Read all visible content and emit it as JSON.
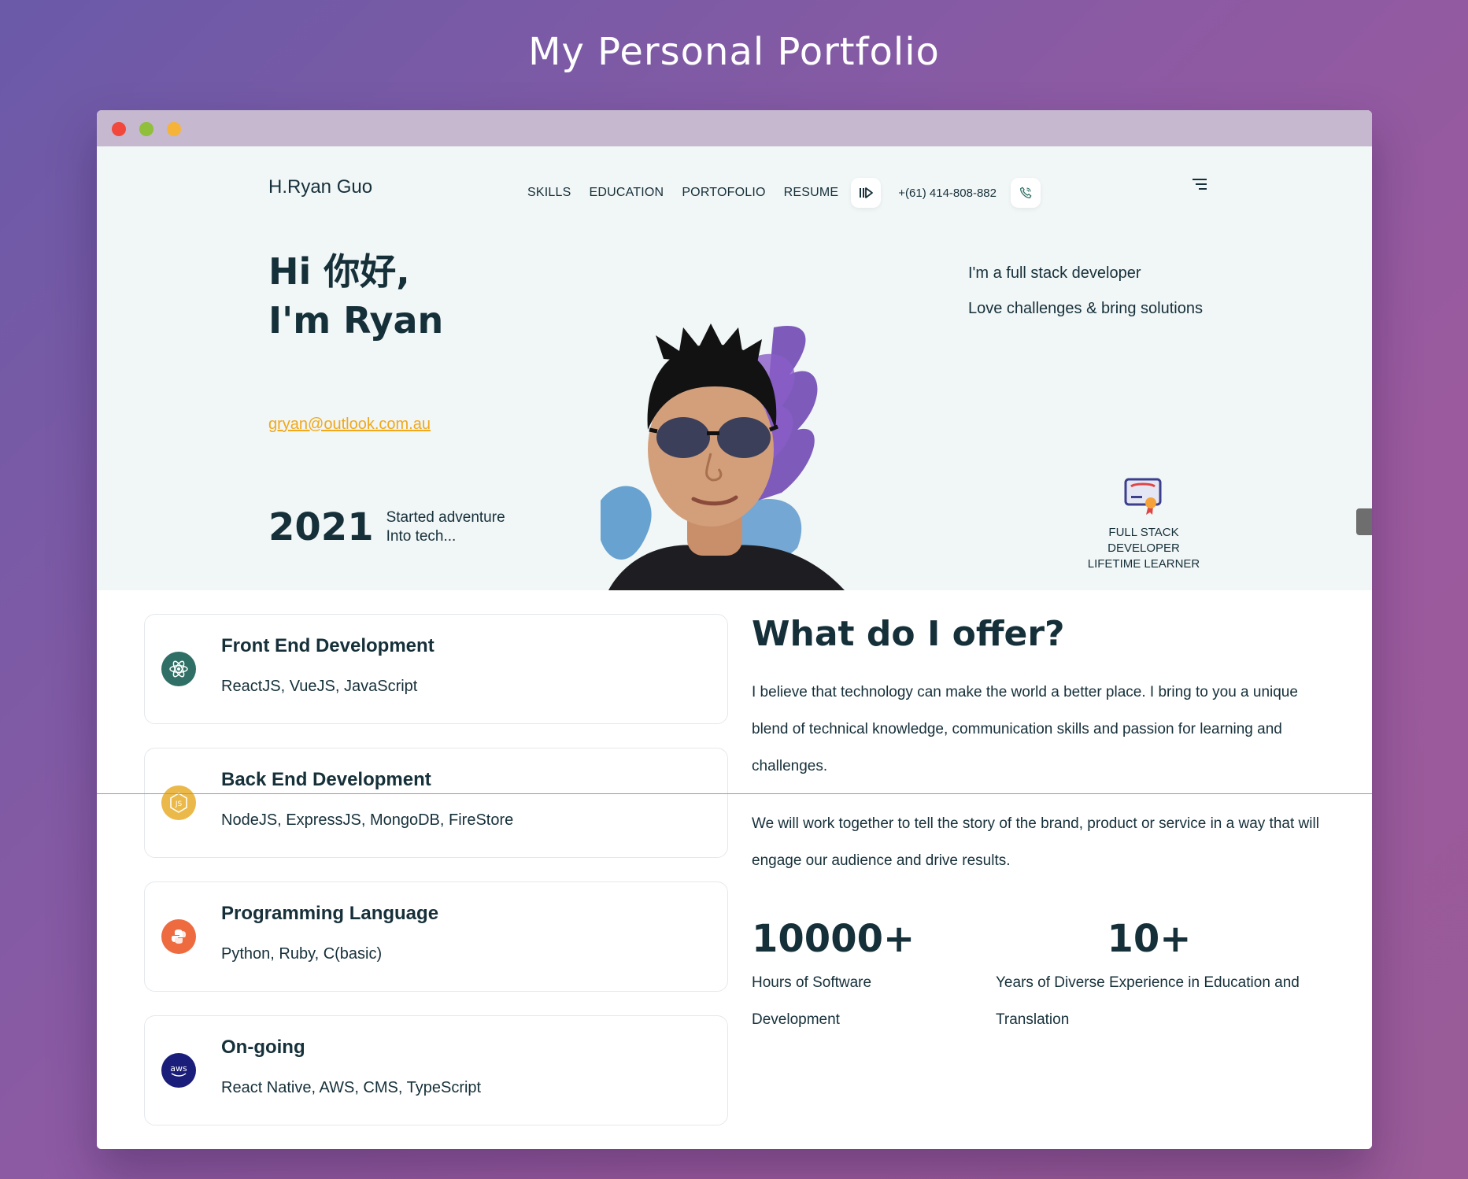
{
  "page_heading": "My  Personal Portfolio",
  "nav": {
    "brand": "H.Ryan Guo",
    "links": [
      "SKILLS",
      "EDUCATION",
      "PORTOFOLIO",
      "RESUME"
    ],
    "phone": "+(61) 414-808-882"
  },
  "hero": {
    "greeting_line1": "Hi 你好,",
    "greeting_line2": "I'm Ryan",
    "email": "gryan@outlook.com.au",
    "year": "2021",
    "year_caption_line1": "Started adventure",
    "year_caption_line2": "Into tech...",
    "tagline1": "I'm a full stack developer",
    "tagline2": "Love challenges & bring solutions",
    "badge_line1": "FULL STACK DEVELOPER",
    "badge_line2": "LIFETIME LEARNER"
  },
  "skills": [
    {
      "title": "Front End Development",
      "text": "ReactJS, VueJS, JavaScript",
      "icon": "react-icon",
      "color": "#2f6f65"
    },
    {
      "title": "Back End Development",
      "text": "NodeJS, ExpressJS, MongoDB, FireStore",
      "icon": "nodejs-icon",
      "color": "#eab94a"
    },
    {
      "title": "Programming Language",
      "text": "Python, Ruby, C(basic)",
      "icon": "python-icon",
      "color": "#ee6a3f"
    },
    {
      "title": "On-going",
      "text": "React Native, AWS, CMS, TypeScript",
      "icon": "aws-icon",
      "color": "#1b1d7a"
    }
  ],
  "offer": {
    "title": "What do I offer?",
    "paragraph1": "I believe that technology can make the world a better place. I bring to you a unique blend of technical knowledge, communication skills and passion for learning and challenges.",
    "paragraph2": "We will work together to tell the story of the brand, product or service in a way that will engage our audience and drive results.",
    "stats": [
      {
        "number": "10000+",
        "label": "Hours of Software Development"
      },
      {
        "number": "10+",
        "label": "Years of Diverse Experience in Education and Translation"
      }
    ]
  },
  "colors": {
    "accent": "#f0a81c",
    "text": "#16303a",
    "hero_bg": "#f1f6f6"
  }
}
